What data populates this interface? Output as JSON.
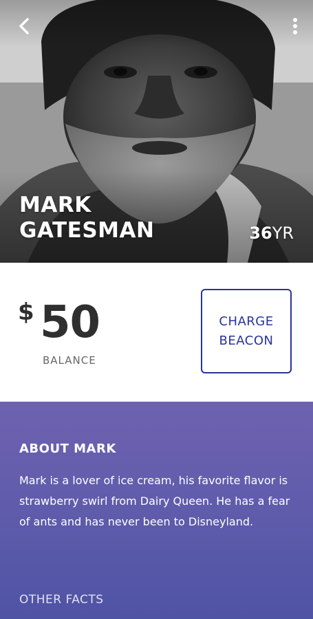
{
  "profile": {
    "first_name": "MARK",
    "last_name": "GATESMAN",
    "age_number": "36",
    "age_unit": "YR"
  },
  "balance": {
    "currency_symbol": "$",
    "amount": "50",
    "label": "BALANCE"
  },
  "actions": {
    "charge_line1": "CHARGE",
    "charge_line2": "BEACON"
  },
  "about": {
    "title": "ABOUT MARK",
    "body": "Mark is a lover of ice cream, his favorite flavor is strawberry swirl from Dairy Queen. He has a fear of ants and has never been to Disneyland.",
    "other_facts": "OTHER FACTS"
  },
  "icons": {
    "back": "chevron-left-icon",
    "menu": "more-vertical-icon"
  },
  "colors": {
    "accent": "#29339a",
    "about_bg_top": "#6e62b0",
    "about_bg_bottom": "#4f53a4",
    "text_dark": "#2f2f2f"
  }
}
